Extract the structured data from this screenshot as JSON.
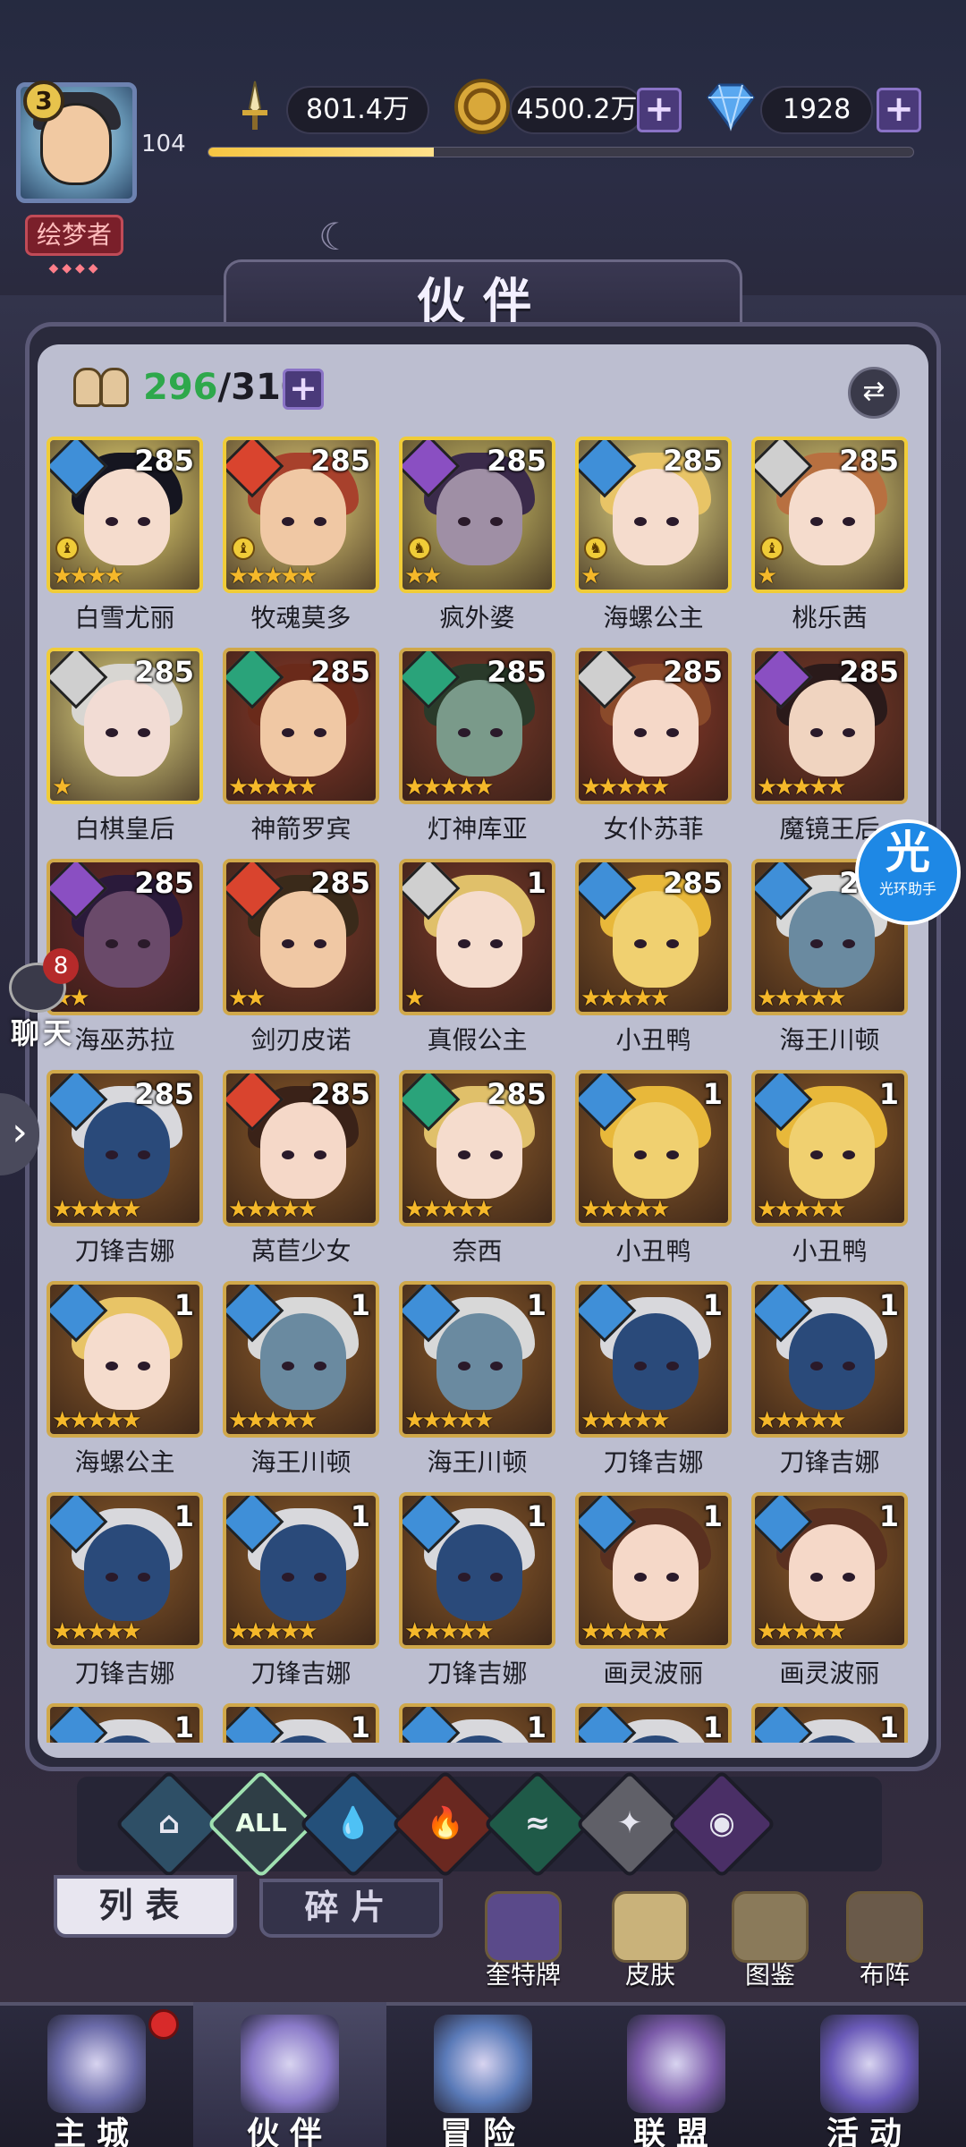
{
  "player": {
    "level": "3",
    "title": "绘梦者",
    "title_dots": "◆◆◆◆",
    "xp_level": "104",
    "xp_progress": 0.32
  },
  "resources": {
    "power": "801.4万",
    "gold": "4500.2万",
    "gems": "1928",
    "plus": "+"
  },
  "header": {
    "title": "伙伴"
  },
  "roster": {
    "current": "296",
    "total": "/310",
    "plus": "+",
    "swap": "⇄"
  },
  "colors": {
    "water": "#3f8fd8",
    "fire": "#d9442e",
    "wind": "#2aa37a",
    "light": "#cfcfcf",
    "dark": "#8a4fc2",
    "star": "#f5b82a",
    "gold_frame": "#f0cc38"
  },
  "cards": [
    {
      "name": "白雪尤丽",
      "level": "285",
      "elem": "water",
      "stars": "★★★★",
      "chess": "♝",
      "gold": true,
      "bg": "#f3e27a",
      "hair": "#151520",
      "skin": "#f5dccd"
    },
    {
      "name": "牧魂莫多",
      "level": "285",
      "elem": "fire",
      "stars": "★★★★★",
      "chess": "♝",
      "gold": true,
      "bg": "#e8d37a",
      "hair": "#a8412c",
      "skin": "#f0c8a4"
    },
    {
      "name": "疯外婆",
      "level": "285",
      "elem": "dark",
      "stars": "★★",
      "chess": "♞",
      "gold": true,
      "bg": "#cfc26a",
      "hair": "#3a2a4a",
      "skin": "#9f8fa5"
    },
    {
      "name": "海螺公主",
      "level": "285",
      "elem": "water",
      "stars": "★",
      "chess": "♞",
      "gold": true,
      "bg": "#e8dc86",
      "hair": "#e8c466",
      "skin": "#f5dccd"
    },
    {
      "name": "桃乐茜",
      "level": "285",
      "elem": "light",
      "stars": "★",
      "chess": "♝",
      "gold": true,
      "bg": "#e0d27a",
      "hair": "#b87040",
      "skin": "#f5dccd"
    },
    {
      "name": "白棋皇后",
      "level": "285",
      "elem": "light",
      "stars": "★",
      "chess": "",
      "gold": true,
      "bg": "#e8dc86",
      "hair": "#d8d6d2",
      "skin": "#f2dcd4"
    },
    {
      "name": "神箭罗宾",
      "level": "285",
      "elem": "wind",
      "stars": "★★★★★",
      "chess": "",
      "gold": false,
      "bg": "#8a3a2a",
      "hair": "#6a2a1a",
      "skin": "#f0c8a4"
    },
    {
      "name": "灯神库亚",
      "level": "285",
      "elem": "wind",
      "stars": "★★★★★",
      "chess": "",
      "gold": false,
      "bg": "#7a3a2a",
      "hair": "#2a3a2a",
      "skin": "#7a9a8a"
    },
    {
      "name": "女仆苏菲",
      "level": "285",
      "elem": "light",
      "stars": "★★★★★",
      "chess": "",
      "gold": false,
      "bg": "#8a3a2a",
      "hair": "#8a4a2a",
      "skin": "#f5d8c8"
    },
    {
      "name": "魔镜王后",
      "level": "285",
      "elem": "dark",
      "stars": "★★★★★",
      "chess": "",
      "gold": false,
      "bg": "#7a3a2a",
      "hair": "#2a1a1a",
      "skin": "#f0d4c0"
    },
    {
      "name": "海巫苏拉",
      "level": "285",
      "elem": "dark",
      "stars": "★★",
      "chess": "",
      "gold": false,
      "bg": "#6a2a2a",
      "hair": "#2a1a3a",
      "skin": "#6a4a6a"
    },
    {
      "name": "剑刃皮诺",
      "level": "285",
      "elem": "fire",
      "stars": "★★",
      "chess": "",
      "gold": false,
      "bg": "#7a3a2a",
      "hair": "#3a2a1a",
      "skin": "#f0c8a4"
    },
    {
      "name": "真假公主",
      "level": "1",
      "elem": "light",
      "stars": "★",
      "chess": "",
      "gold": false,
      "bg": "#7a3a2a",
      "hair": "#e0c06a",
      "skin": "#f5dccd"
    },
    {
      "name": "小丑鸭",
      "level": "285",
      "elem": "water",
      "stars": "★★★★★",
      "chess": "",
      "gold": false,
      "bg": "#8a5a2a",
      "hair": "#e8b83a",
      "skin": "#f0d070"
    },
    {
      "name": "海王川顿",
      "level": "285",
      "elem": "water",
      "stars": "★★★★★",
      "chess": "",
      "gold": false,
      "bg": "#8a5a2a",
      "hair": "#d8d8d8",
      "skin": "#6a8aa0"
    },
    {
      "name": "刀锋吉娜",
      "level": "285",
      "elem": "water",
      "stars": "★★★★★",
      "chess": "",
      "gold": false,
      "bg": "#8a5a2a",
      "hair": "#d8d8dc",
      "skin": "#2a4a7a"
    },
    {
      "name": "莴苣少女",
      "level": "285",
      "elem": "fire",
      "stars": "★★★★★",
      "chess": "",
      "gold": false,
      "bg": "#8a5a2a",
      "hair": "#3a2218",
      "skin": "#f5d8c8"
    },
    {
      "name": "奈西",
      "level": "285",
      "elem": "wind",
      "stars": "★★★★★",
      "chess": "",
      "gold": false,
      "bg": "#8a5a2a",
      "hair": "#e0c06a",
      "skin": "#f5dccd"
    },
    {
      "name": "小丑鸭",
      "level": "1",
      "elem": "water",
      "stars": "★★★★★",
      "chess": "",
      "gold": false,
      "bg": "#8a5a2a",
      "hair": "#e8b83a",
      "skin": "#f0d070"
    },
    {
      "name": "小丑鸭",
      "level": "1",
      "elem": "water",
      "stars": "★★★★★",
      "chess": "",
      "gold": false,
      "bg": "#8a5a2a",
      "hair": "#e8b83a",
      "skin": "#f0d070"
    },
    {
      "name": "海螺公主",
      "level": "1",
      "elem": "water",
      "stars": "★★★★★",
      "chess": "",
      "gold": false,
      "bg": "#8a5a2a",
      "hair": "#e8c466",
      "skin": "#f5dccd"
    },
    {
      "name": "海王川顿",
      "level": "1",
      "elem": "water",
      "stars": "★★★★★",
      "chess": "",
      "gold": false,
      "bg": "#8a5a2a",
      "hair": "#d8d8d8",
      "skin": "#6a8aa0"
    },
    {
      "name": "海王川顿",
      "level": "1",
      "elem": "water",
      "stars": "★★★★★",
      "chess": "",
      "gold": false,
      "bg": "#8a5a2a",
      "hair": "#d8d8d8",
      "skin": "#6a8aa0"
    },
    {
      "name": "刀锋吉娜",
      "level": "1",
      "elem": "water",
      "stars": "★★★★★",
      "chess": "",
      "gold": false,
      "bg": "#8a5a2a",
      "hair": "#d8d8dc",
      "skin": "#2a4a7a"
    },
    {
      "name": "刀锋吉娜",
      "level": "1",
      "elem": "water",
      "stars": "★★★★★",
      "chess": "",
      "gold": false,
      "bg": "#8a5a2a",
      "hair": "#d8d8dc",
      "skin": "#2a4a7a"
    },
    {
      "name": "刀锋吉娜",
      "level": "1",
      "elem": "water",
      "stars": "★★★★★",
      "chess": "",
      "gold": false,
      "bg": "#8a5a2a",
      "hair": "#d8d8dc",
      "skin": "#2a4a7a"
    },
    {
      "name": "刀锋吉娜",
      "level": "1",
      "elem": "water",
      "stars": "★★★★★",
      "chess": "",
      "gold": false,
      "bg": "#8a5a2a",
      "hair": "#d8d8dc",
      "skin": "#2a4a7a"
    },
    {
      "name": "刀锋吉娜",
      "level": "1",
      "elem": "water",
      "stars": "★★★★★",
      "chess": "",
      "gold": false,
      "bg": "#8a5a2a",
      "hair": "#d8d8dc",
      "skin": "#2a4a7a"
    },
    {
      "name": "画灵波丽",
      "level": "1",
      "elem": "water",
      "stars": "★★★★★",
      "chess": "",
      "gold": false,
      "bg": "#8a5a2a",
      "hair": "#5a3020",
      "skin": "#f5d8c8"
    },
    {
      "name": "画灵波丽",
      "level": "1",
      "elem": "water",
      "stars": "★★★★★",
      "chess": "",
      "gold": false,
      "bg": "#8a5a2a",
      "hair": "#5a3020",
      "skin": "#f5d8c8"
    },
    {
      "name": "",
      "level": "1",
      "elem": "water",
      "stars": "",
      "chess": "",
      "gold": false,
      "bg": "#8a5a2a",
      "hair": "#d8d8dc",
      "skin": "#2a4a7a"
    },
    {
      "name": "",
      "level": "1",
      "elem": "water",
      "stars": "",
      "chess": "",
      "gold": false,
      "bg": "#8a5a2a",
      "hair": "#d8d8dc",
      "skin": "#2a4a7a"
    },
    {
      "name": "",
      "level": "1",
      "elem": "water",
      "stars": "",
      "chess": "",
      "gold": false,
      "bg": "#8a5a2a",
      "hair": "#d8d8dc",
      "skin": "#2a4a7a"
    },
    {
      "name": "",
      "level": "1",
      "elem": "water",
      "stars": "",
      "chess": "",
      "gold": false,
      "bg": "#8a5a2a",
      "hair": "#d8d8dc",
      "skin": "#2a4a7a"
    },
    {
      "name": "",
      "level": "1",
      "elem": "water",
      "stars": "",
      "chess": "",
      "gold": false,
      "bg": "#8a5a2a",
      "hair": "#d8d8dc",
      "skin": "#2a4a7a"
    }
  ],
  "element_tabs": [
    {
      "key": "abyss",
      "glyph": "⌂",
      "color": "#2e4f66"
    },
    {
      "key": "all",
      "glyph": "ALL",
      "color": "#2f3e46"
    },
    {
      "key": "water",
      "glyph": "💧",
      "color": "#24507a"
    },
    {
      "key": "fire",
      "glyph": "🔥",
      "color": "#6a2820"
    },
    {
      "key": "wind",
      "glyph": "≈",
      "color": "#1f5a48"
    },
    {
      "key": "light",
      "glyph": "✦",
      "color": "#606068"
    },
    {
      "key": "dark",
      "glyph": "◉",
      "color": "#4a2f66"
    }
  ],
  "tabs": {
    "list": "列表",
    "shards": "碎片"
  },
  "shortcuts": [
    {
      "label": "奎特牌",
      "icon": "card-icon"
    },
    {
      "label": "皮肤",
      "icon": "skin-icon"
    },
    {
      "label": "图鉴",
      "icon": "book-icon"
    },
    {
      "label": "布阵",
      "icon": "formation-icon"
    }
  ],
  "nav": [
    {
      "label": "主城",
      "icon": "castle-icon"
    },
    {
      "label": "伙伴",
      "icon": "partner-icon"
    },
    {
      "label": "冒险",
      "icon": "adventure-icon"
    },
    {
      "label": "联盟",
      "icon": "alliance-icon"
    },
    {
      "label": "活动",
      "icon": "event-icon"
    }
  ],
  "chat": {
    "label": "聊天",
    "badge": "8"
  },
  "helper": {
    "big": "光",
    "small": "光环助手"
  }
}
